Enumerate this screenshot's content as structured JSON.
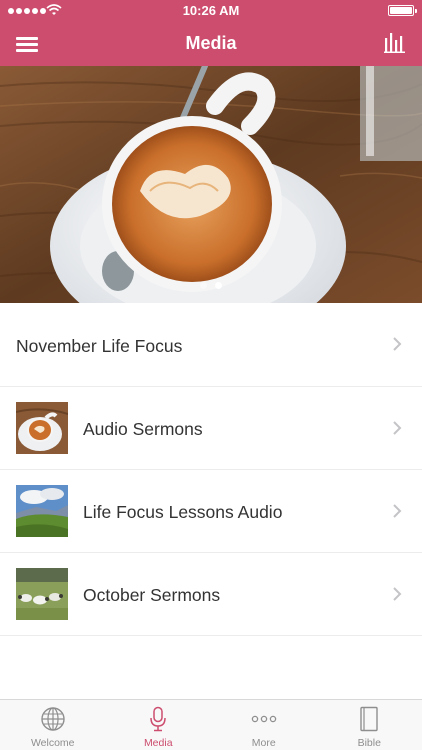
{
  "status_bar": {
    "time": "10:26 AM"
  },
  "nav": {
    "title": "Media",
    "menu_icon": "hamburger-menu-icon",
    "right_icon": "equalizer-bars-icon"
  },
  "hero": {
    "slide_count": 2,
    "active_slide": 2
  },
  "list": {
    "items": [
      {
        "label": "November Life Focus"
      },
      {
        "label": "Audio Sermons"
      },
      {
        "label": "Life Focus Lessons Audio"
      },
      {
        "label": "October Sermons"
      }
    ]
  },
  "tabbar": {
    "tabs": [
      {
        "label": "Welcome",
        "icon": "globe-icon"
      },
      {
        "label": "Media",
        "icon": "microphone-icon"
      },
      {
        "label": "More",
        "icon": "more-dots-icon"
      },
      {
        "label": "Bible",
        "icon": "book-icon"
      }
    ],
    "active": "Media"
  },
  "colors": {
    "accent": "#cc4d6e",
    "inactive": "#8e8e8e",
    "separator": "#ececec"
  }
}
